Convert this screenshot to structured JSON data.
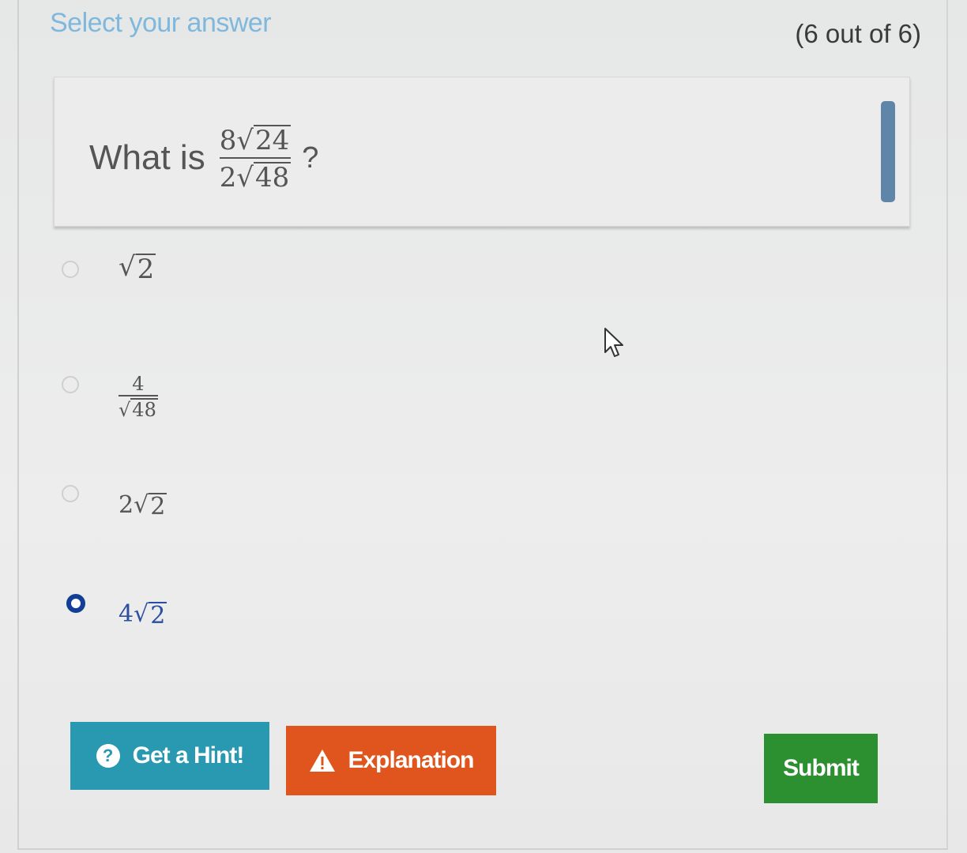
{
  "header": {
    "title": "Select your answer",
    "progress": "(6 out of 6)"
  },
  "question": {
    "prefix": "What is",
    "numerator_coef": "8",
    "numerator_radicand": "24",
    "denominator_coef": "2",
    "denominator_radicand": "48",
    "suffix": "?"
  },
  "options": [
    {
      "coef": "",
      "radicand": "2",
      "selected": false
    },
    {
      "numerator": "4",
      "radicand": "48",
      "selected": false
    },
    {
      "coef": "2",
      "radicand": "2",
      "selected": false
    },
    {
      "coef": "4",
      "radicand": "2",
      "selected": true
    }
  ],
  "buttons": {
    "hint": "Get a Hint!",
    "explanation": "Explanation",
    "submit": "Submit"
  },
  "icons": {
    "hint": "question-circle-icon",
    "explanation": "warning-triangle-icon",
    "cursor": "mouse-pointer-icon"
  },
  "colors": {
    "title": "#7fb8dc",
    "hint_button": "#2998b1",
    "explanation_button": "#e0551e",
    "submit_button": "#2c8f30",
    "selected_radio": "#123f95"
  }
}
